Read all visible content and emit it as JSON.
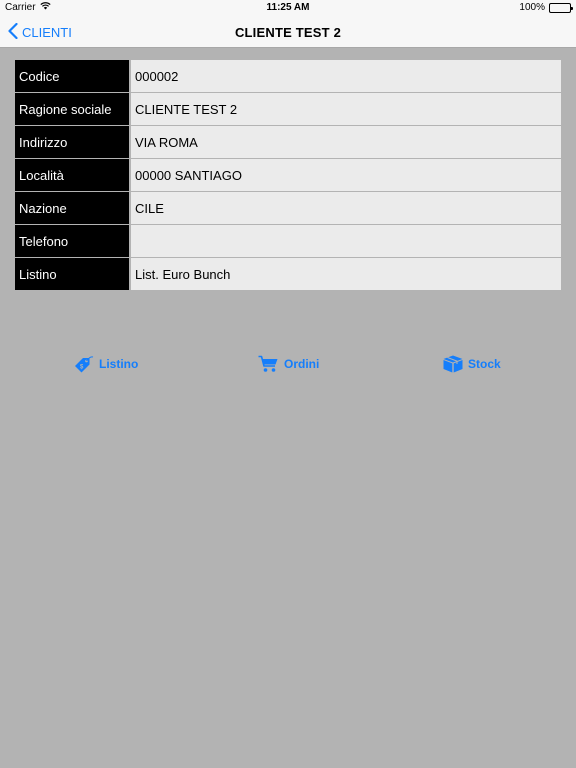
{
  "status_bar": {
    "carrier": "Carrier",
    "time": "11:25 AM",
    "battery": "100%",
    "battery_level": 1.0
  },
  "nav": {
    "back_label": "CLIENTI",
    "title": "CLIENTE TEST 2"
  },
  "details": [
    {
      "label": "Codice",
      "value": "000002"
    },
    {
      "label": "Ragione sociale",
      "value": "CLIENTE TEST 2"
    },
    {
      "label": "Indirizzo",
      "value": "VIA ROMA"
    },
    {
      "label": "Località",
      "value": "00000 SANTIAGO"
    },
    {
      "label": "Nazione",
      "value": "CILE"
    },
    {
      "label": "Telefono",
      "value": ""
    },
    {
      "label": "Listino",
      "value": "List. Euro Bunch"
    }
  ],
  "actions": {
    "listino": {
      "label": "Listino",
      "icon": "price-tag-icon"
    },
    "ordini": {
      "label": "Ordini",
      "icon": "cart-icon"
    },
    "stock": {
      "label": "Stock",
      "icon": "box-icon"
    }
  },
  "colors": {
    "accent": "#157efb",
    "background": "#b3b3b3",
    "label_bg": "#000000",
    "value_bg": "#ebebeb"
  }
}
